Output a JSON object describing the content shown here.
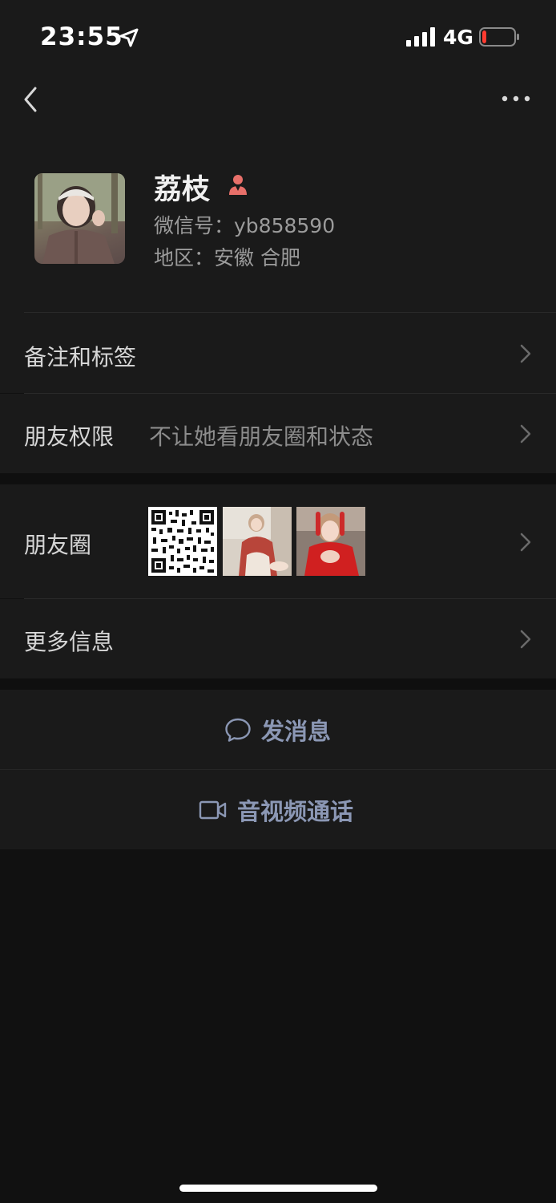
{
  "status_bar": {
    "time": "23:55",
    "network": "4G",
    "battery_level": 0.12,
    "battery_color": "#ff3b30"
  },
  "nav": {
    "back_icon": "chevron-left-icon",
    "more_icon": "more-dots-icon"
  },
  "profile": {
    "name": "荔枝",
    "gender_icon": "female-icon",
    "gender_color": "#e8706a",
    "wechat_id": "微信号：yb858590",
    "region": "地区：安徽 合肥"
  },
  "rows": {
    "remarks_label": "备注和标签",
    "permissions_label": "朋友权限",
    "permissions_value": "不让她看朋友圈和状态",
    "moments_label": "朋友圈",
    "more_info_label": "更多信息"
  },
  "actions": {
    "message_label": "发消息",
    "message_icon": "chat-bubble-icon",
    "call_label": "音视频通话",
    "call_icon": "video-camera-icon",
    "accent_color": "#8b97b4"
  }
}
